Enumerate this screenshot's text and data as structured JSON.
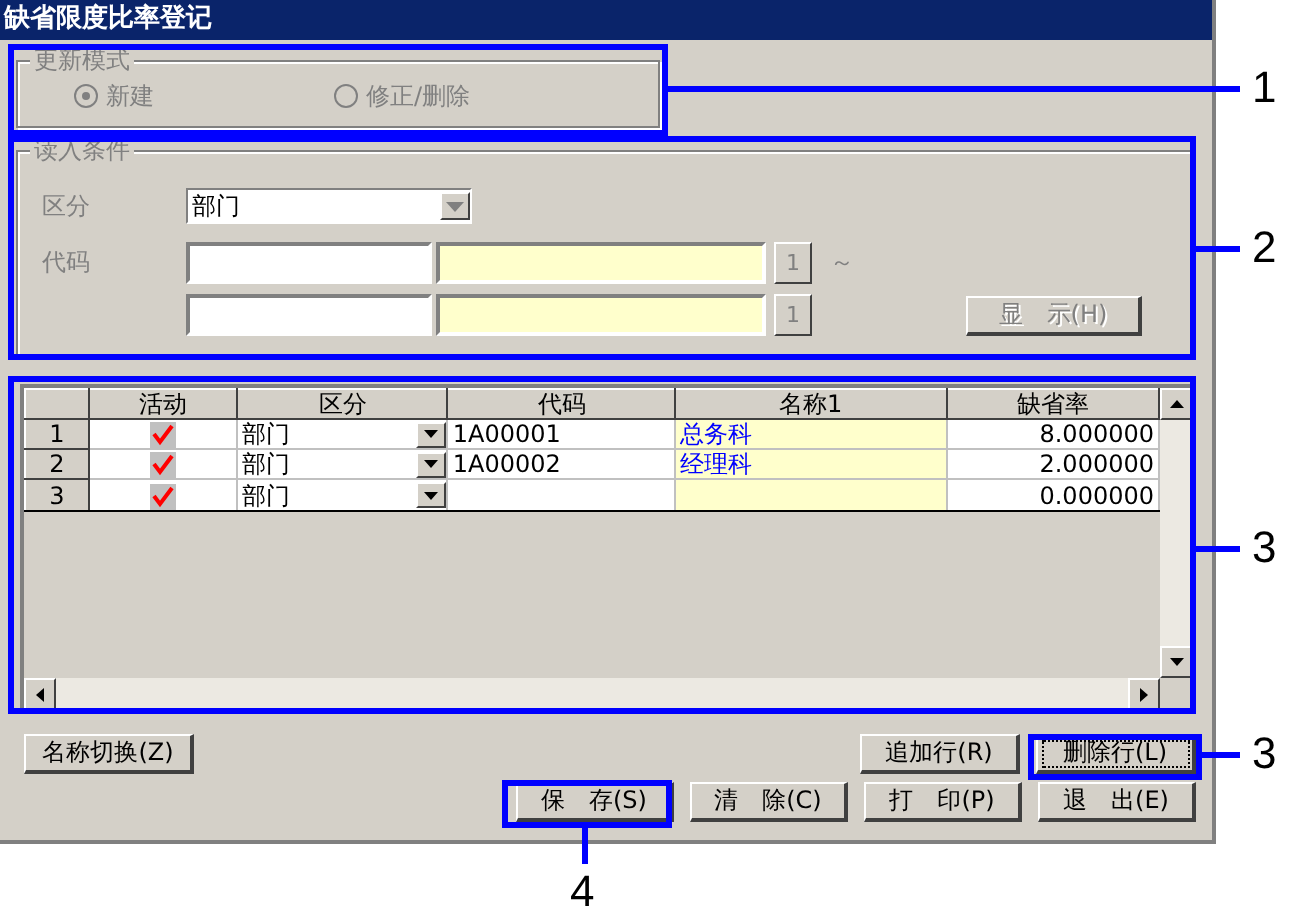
{
  "window": {
    "title": "缺省限度比率登记"
  },
  "update_mode": {
    "legend": "更新模式",
    "disabled": true,
    "options": [
      {
        "label": "新建",
        "selected": true
      },
      {
        "label": "修正/删除",
        "selected": false
      }
    ]
  },
  "read_conditions": {
    "legend": "读入条件",
    "disabled": true,
    "division_label": "区分",
    "division_value": "部门",
    "code_label": "代码",
    "lookup_buttons": [
      "1",
      "1"
    ],
    "range_sign": "～",
    "display_button": "显　示(H)"
  },
  "grid": {
    "columns": [
      "活动",
      "区分",
      "代码",
      "名称1",
      "缺省率"
    ],
    "rows": [
      {
        "number": "1",
        "active": true,
        "division": "部门",
        "code": "1A00001",
        "name": "总务科",
        "rate": "8.000000"
      },
      {
        "number": "2",
        "active": true,
        "division": "部门",
        "code": "1A00002",
        "name": "经理科",
        "rate": "2.000000"
      },
      {
        "number": "3",
        "active": true,
        "division": "部门",
        "rate": "0.000000"
      }
    ]
  },
  "buttons_top": [
    {
      "label": "名称切换(Z)",
      "focused": false
    },
    {
      "label": "追加行(R)",
      "focused": false
    },
    {
      "label": "删除行(L)",
      "focused": true
    }
  ],
  "buttons_bottom": [
    {
      "label": "保　存(S)",
      "focused": false
    },
    {
      "label": "清　除(C)",
      "focused": false
    },
    {
      "label": "打　印(P)",
      "focused": false
    },
    {
      "label": "退　出(E)",
      "focused": false
    }
  ],
  "callouts": [
    {
      "number": "1"
    },
    {
      "number": "2"
    },
    {
      "number": "3"
    },
    {
      "number": "3"
    },
    {
      "number": "4"
    }
  ]
}
